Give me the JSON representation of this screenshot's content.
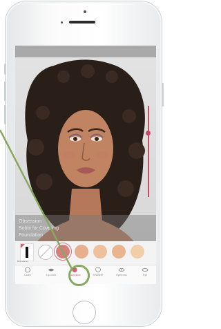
{
  "app": {
    "caption": {
      "line1": "Obsession",
      "line2": "Bobbi for Covering",
      "line3": "Foundation"
    },
    "brand_label": "Bbw Harvey",
    "swatches": [
      {
        "id": "none",
        "color": "#ffffff",
        "selected": false
      },
      {
        "id": "s1",
        "color": "#d47f7b",
        "selected": true
      },
      {
        "id": "s2",
        "color": "#e6b08c",
        "selected": false
      },
      {
        "id": "s3",
        "color": "#ecc19b",
        "selected": false
      },
      {
        "id": "s4",
        "color": "#e9b48e",
        "selected": false
      },
      {
        "id": "s5",
        "color": "#f1cda8",
        "selected": false
      }
    ],
    "intensity_level": 0.7,
    "nav": [
      {
        "label": "Looks",
        "icon": "face-icon"
      },
      {
        "label": "Lip Color",
        "icon": "lips-icon"
      },
      {
        "label": "Foundation",
        "icon": "foundation-icon",
        "active": true
      },
      {
        "label": "Smoother",
        "icon": "head-icon"
      },
      {
        "label": "Eyebrows",
        "icon": "eye-icon"
      },
      {
        "label": "Eye",
        "icon": "eye-icon"
      }
    ]
  },
  "colors": {
    "accent": "#d35d72",
    "callout": "#86a860",
    "slider": "#c84b63"
  }
}
